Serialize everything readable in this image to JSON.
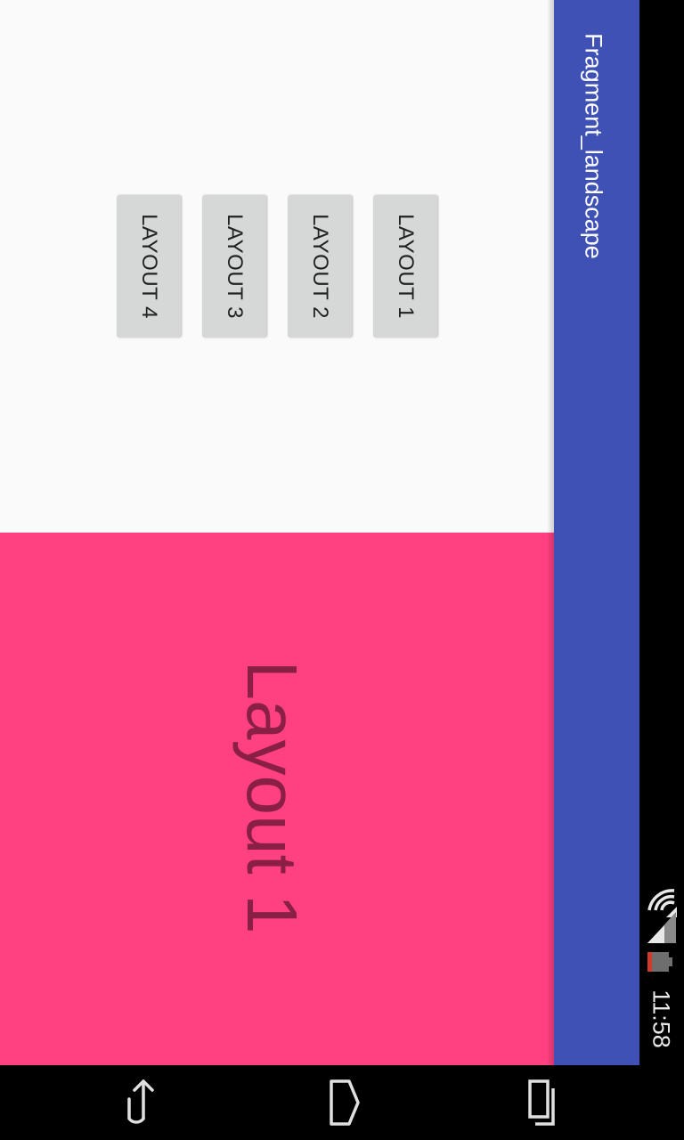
{
  "app_bar": {
    "title": "Fragment_landscape",
    "color": "#3f51b5"
  },
  "status_bar": {
    "time": "11:58",
    "icons": [
      "wifi-icon",
      "signal-icon",
      "battery-icon"
    ]
  },
  "buttons": {
    "layout_1": "LAYOUT 1",
    "layout_2": "LAYOUT 2",
    "layout_3": "LAYOUT 3",
    "layout_4": "LAYOUT 4"
  },
  "display": {
    "text": "Layout 1",
    "background": "#ff4081"
  },
  "nav_bar": {
    "icons": [
      "back-icon",
      "home-icon",
      "recents-icon"
    ]
  }
}
